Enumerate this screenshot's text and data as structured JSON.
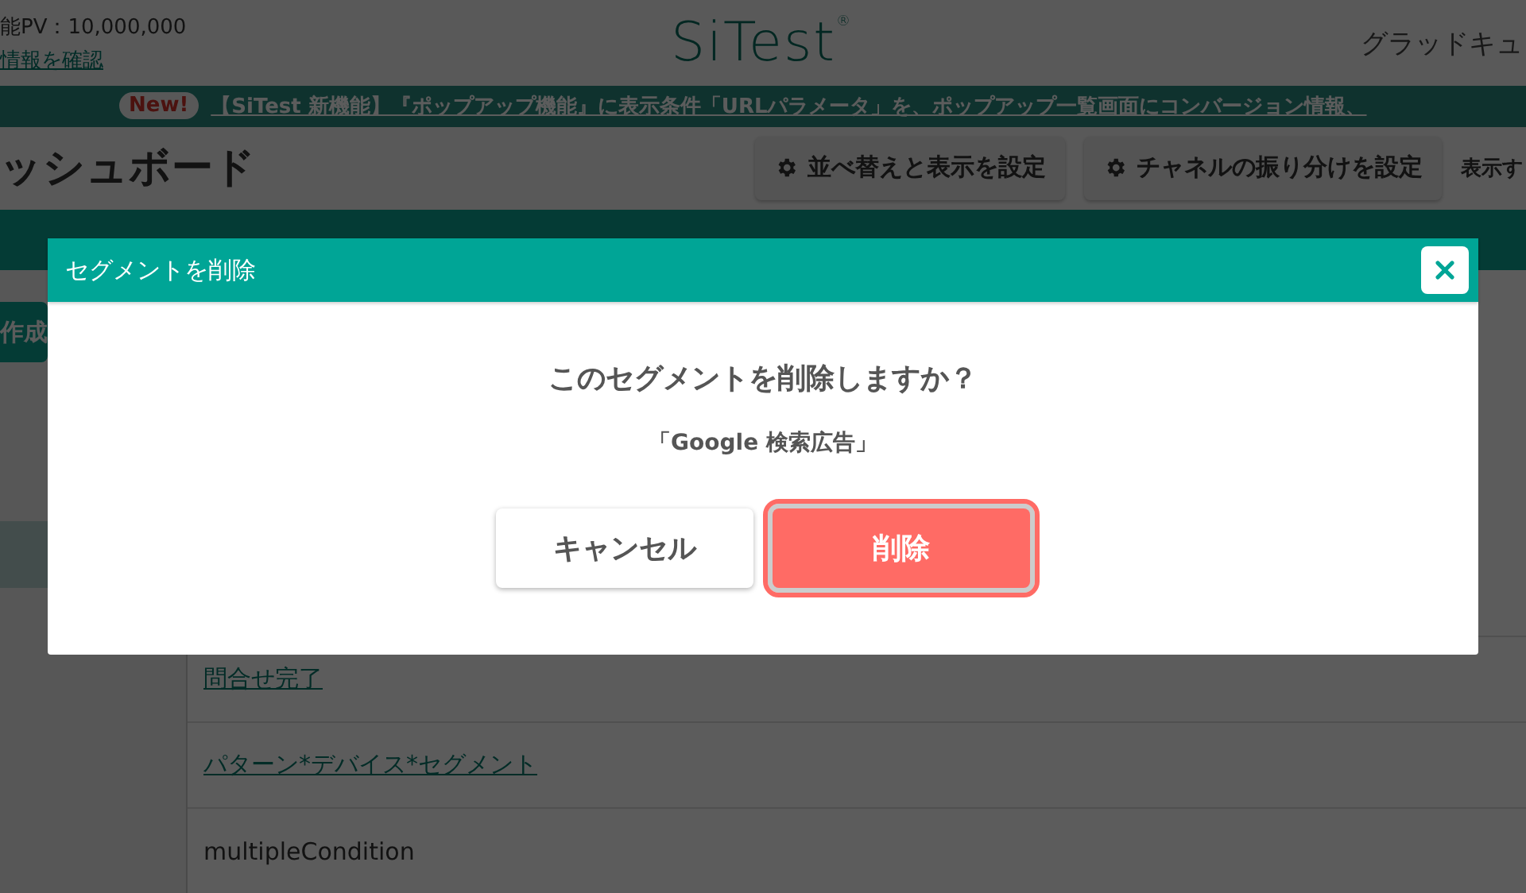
{
  "header": {
    "pv_text": "能PV：10,000,000",
    "info_link": "情報を確認",
    "logo": "SiTest",
    "logo_mark": "®",
    "user": "グラッドキュ"
  },
  "notice": {
    "badge": "New!",
    "text": "【SiTest 新機能】『ポップアップ機能』に表示条件「URLパラメータ」を、ポップアップ一覧画面にコンバージョン情報、"
  },
  "page": {
    "title": "ッシュボード",
    "buttons": [
      "並べ替えと表示を設定",
      "チャネルの振り分けを設定"
    ],
    "trailing": "表示す"
  },
  "sidebar": {
    "create_button": "作成"
  },
  "segments": [
    {
      "label": "問合せ完了",
      "kind": "link"
    },
    {
      "label": "パターン*デバイス*セグメント",
      "kind": "link"
    },
    {
      "label": "multipleCondition",
      "kind": "text"
    }
  ],
  "dialog": {
    "title": "セグメントを削除",
    "question": "このセグメントを削除しますか？",
    "target": "「Google 検索広告」",
    "buttons": [
      {
        "label": "キャンセル",
        "kind": "cancel",
        "focused": false
      },
      {
        "label": "削除",
        "kind": "danger",
        "focused": true
      }
    ]
  }
}
